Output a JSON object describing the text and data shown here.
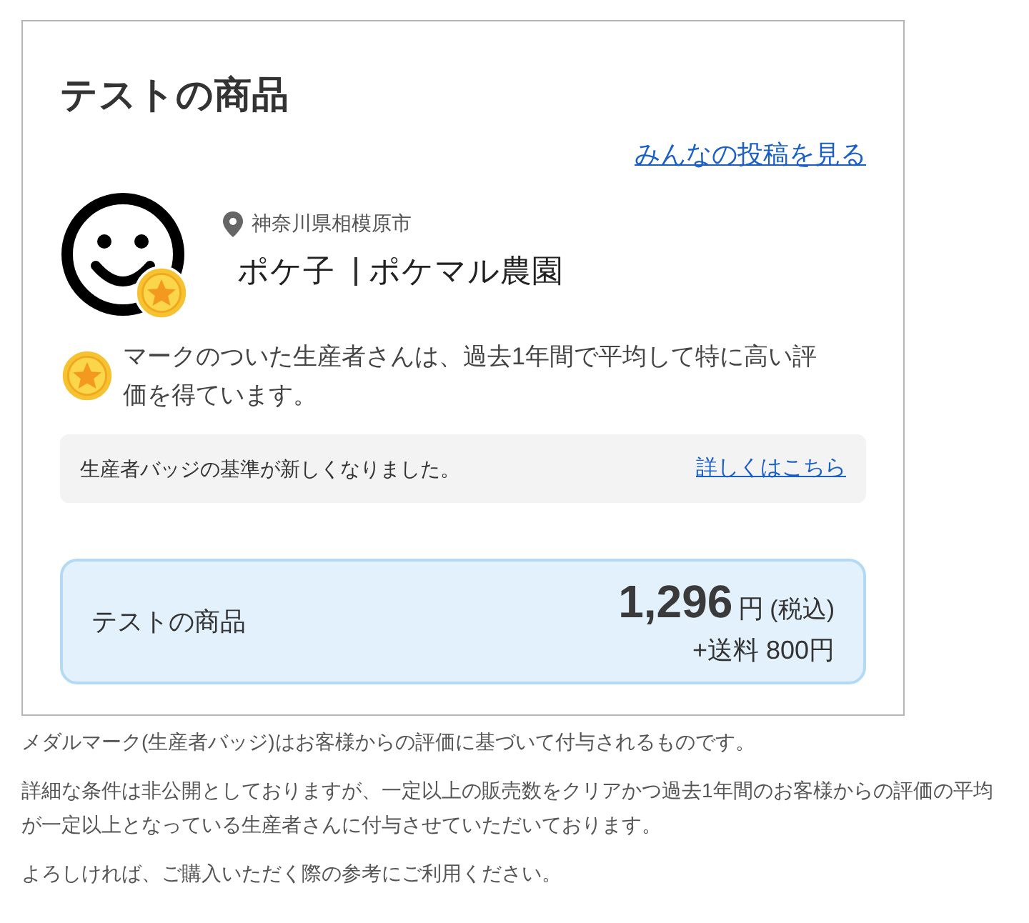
{
  "product": {
    "title": "テストの商品",
    "posts_link": "みんなの投稿を見る"
  },
  "producer": {
    "location": "神奈川県相模原市",
    "name": "ポケ子",
    "farm": "ポケマル農園",
    "medal": true
  },
  "medal_note": "マークのついた生産者さんは、過去1年間で平均して特に高い評価を得ています。",
  "notice": {
    "text": "生産者バッジの基準が新しくなりました。",
    "link": "詳しくはこちら"
  },
  "price_box": {
    "name": "テストの商品",
    "price": "1,296",
    "unit": "円",
    "tax": "(税込)",
    "shipping": "+送料 800円"
  },
  "footnotes": [
    "メダルマーク(生産者バッジ)はお客様からの評価に基づいて付与されるものです。",
    "詳細な条件は非公開としておりますが、一定以上の販売数をクリアかつ過去1年間のお客様からの評価の平均が一定以上となっている生産者さんに付与させていただいております。",
    "よろしければ、ご購入いただく際の参考にご利用ください。"
  ]
}
